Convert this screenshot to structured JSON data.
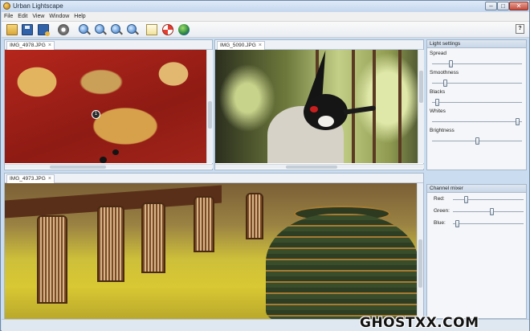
{
  "window": {
    "title": "Urban Lightscape",
    "controls": {
      "minimize": "–",
      "maximize": "□",
      "close": "✕"
    }
  },
  "menu": [
    {
      "label": "File"
    },
    {
      "label": "Edit"
    },
    {
      "label": "View"
    },
    {
      "label": "Window"
    },
    {
      "label": "Help"
    }
  ],
  "toolbar": {
    "icons": [
      "open-folder-icon",
      "save-icon",
      "save-as-icon",
      "settings-icon",
      "zoom-in-icon",
      "zoom-out-icon",
      "zoom-fit-icon",
      "zoom-actual-icon",
      "image-icon",
      "help-lifebuoy-icon",
      "web-globe-icon"
    ],
    "help_label": "?"
  },
  "panes": {
    "top_left": {
      "tab": "IMG_4978.JPG",
      "marker_label": "1"
    },
    "top_right": {
      "tab": "IMG_5090.JPG"
    },
    "bottom": {
      "tab": "IMG_4973.JPG"
    },
    "tab_close": "×"
  },
  "light_settings": {
    "title": "Light settings",
    "sliders": [
      {
        "label": "Spread",
        "value": 0.2
      },
      {
        "label": "Smoothness",
        "value": 0.13
      },
      {
        "label": "Blacks",
        "value": 0.04
      },
      {
        "label": "Whites",
        "value": 0.97
      },
      {
        "label": "Brightness",
        "value": 0.5
      }
    ]
  },
  "channel_mixer": {
    "title": "Channel mixer",
    "sliders": [
      {
        "label": "Red:",
        "value": 0.17
      },
      {
        "label": "Green:",
        "value": 0.55
      },
      {
        "label": "Blue:",
        "value": 0.04
      }
    ]
  },
  "watermark": "GHOSTXX.COM"
}
